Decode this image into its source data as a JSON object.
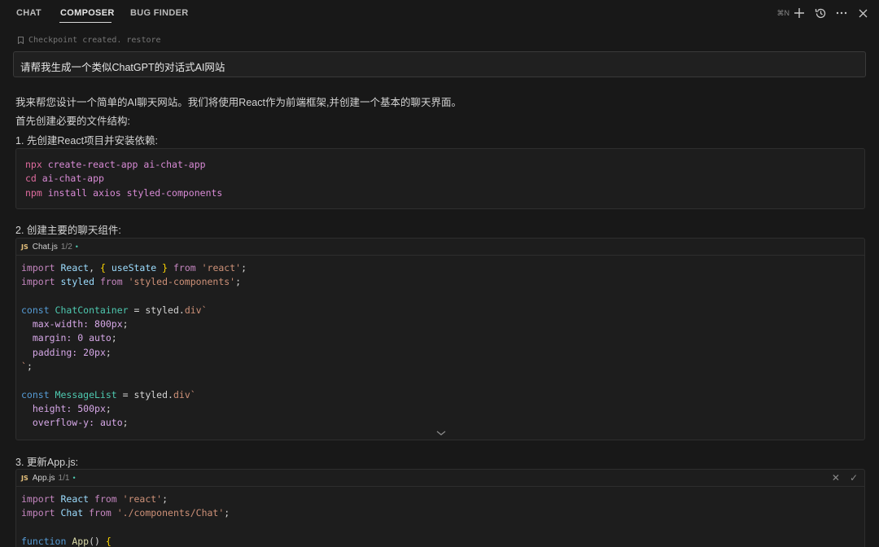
{
  "tabs": [
    {
      "label": "CHAT"
    },
    {
      "label": "COMPOSER"
    },
    {
      "label": "BUG FINDER"
    }
  ],
  "top_actions": {
    "shortcut": "⌘N"
  },
  "checkpoint": {
    "text": "Checkpoint created.",
    "restore": "restore"
  },
  "prompt": "请帮我生成一个类似ChatGPT的对话式AI网站",
  "intro": "我来帮您设计一个简单的AI聊天网站。我们将使用React作为前端框架,并创建一个基本的聊天界面。",
  "structure_note": "首先创建必要的文件结构:",
  "step1": "1. 先创建React项目并安装依赖:",
  "shell": [
    {
      "cmd": "npx",
      "args": " create-react-app ai-chat-app"
    },
    {
      "cmd": "cd",
      "args": " ai-chat-app"
    },
    {
      "cmd": "npm",
      "args": " install axios styled-components"
    }
  ],
  "step2": "2. 创建主要的聊天组件:",
  "chat_file": {
    "badge": "JS",
    "name": "Chat.js",
    "count": "1/2",
    "dot": "•"
  },
  "step3": "3. 更新App.js:",
  "app_file": {
    "badge": "JS",
    "name": "App.js",
    "count": "1/1",
    "dot": "•",
    "reject": "✕",
    "accept": "✓"
  },
  "chat_code": [
    [
      [
        "import ",
        "t-kw"
      ],
      [
        "React",
        "t-id"
      ],
      [
        ", ",
        "t-plain"
      ],
      [
        "{ ",
        "t-brace"
      ],
      [
        "useState",
        "t-id"
      ],
      [
        " } ",
        "t-brace"
      ],
      [
        "from ",
        "t-kw"
      ],
      [
        "'react'",
        "t-str"
      ],
      [
        ";",
        "t-plain"
      ]
    ],
    [
      [
        "import ",
        "t-kw"
      ],
      [
        "styled ",
        "t-id"
      ],
      [
        "from ",
        "t-kw"
      ],
      [
        "'styled-components'",
        "t-str"
      ],
      [
        ";",
        "t-plain"
      ]
    ],
    [],
    [
      [
        "const ",
        "t-kw2"
      ],
      [
        "ChatContainer",
        "t-type"
      ],
      [
        " = styled.",
        "t-plain"
      ],
      [
        "div",
        "t-tag"
      ],
      [
        "`",
        "t-str"
      ]
    ],
    [
      [
        "  max-width: ",
        "t-prop"
      ],
      [
        "800px",
        "t-num"
      ],
      [
        ";",
        "t-plain"
      ]
    ],
    [
      [
        "  margin: ",
        "t-prop"
      ],
      [
        "0 auto",
        "t-num"
      ],
      [
        ";",
        "t-plain"
      ]
    ],
    [
      [
        "  padding: ",
        "t-prop"
      ],
      [
        "20px",
        "t-num"
      ],
      [
        ";",
        "t-plain"
      ]
    ],
    [
      [
        "`",
        "t-str"
      ],
      [
        ";",
        "t-plain"
      ]
    ],
    [],
    [
      [
        "const ",
        "t-kw2"
      ],
      [
        "MessageList",
        "t-type"
      ],
      [
        " = styled.",
        "t-plain"
      ],
      [
        "div",
        "t-tag"
      ],
      [
        "`",
        "t-str"
      ]
    ],
    [
      [
        "  height: ",
        "t-prop"
      ],
      [
        "500px",
        "t-num"
      ],
      [
        ";",
        "t-plain"
      ]
    ],
    [
      [
        "  overflow-y: ",
        "t-prop"
      ],
      [
        "auto",
        "t-num"
      ],
      [
        ";",
        "t-plain"
      ]
    ]
  ],
  "app_code": [
    [
      [
        "import ",
        "t-kw"
      ],
      [
        "React ",
        "t-id"
      ],
      [
        "from ",
        "t-kw"
      ],
      [
        "'react'",
        "t-str"
      ],
      [
        ";",
        "t-plain"
      ]
    ],
    [
      [
        "import ",
        "t-kw"
      ],
      [
        "Chat ",
        "t-id"
      ],
      [
        "from ",
        "t-kw"
      ],
      [
        "'./components/Chat'",
        "t-str"
      ],
      [
        ";",
        "t-plain"
      ]
    ],
    [],
    [
      [
        "function ",
        "t-kw2"
      ],
      [
        "App",
        "t-fn"
      ],
      [
        "() ",
        "t-plain"
      ],
      [
        "{",
        "t-brace"
      ]
    ]
  ]
}
